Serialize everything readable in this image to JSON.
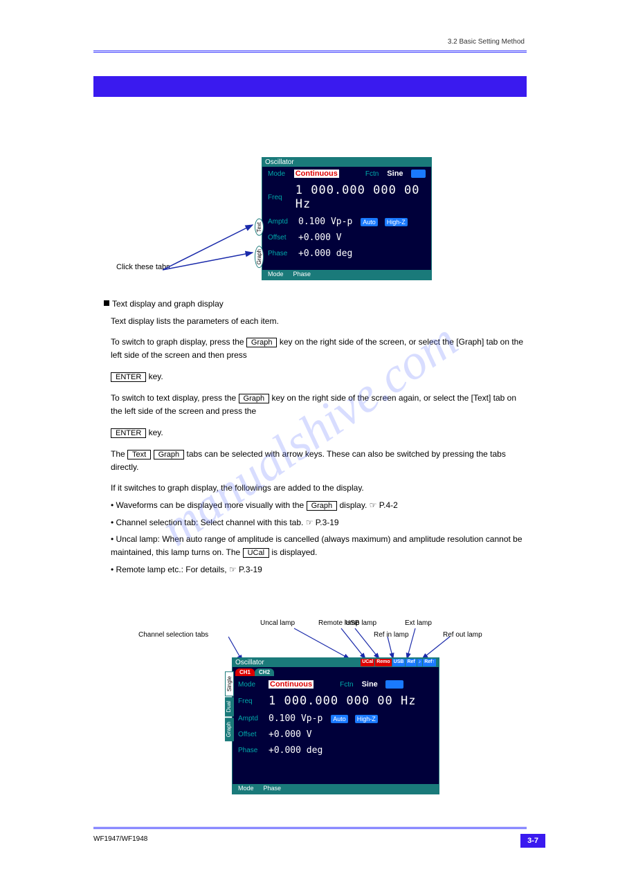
{
  "header_right": "3.2 Basic Setting Method",
  "bar_title": "",
  "device": {
    "title": "Oscillator",
    "mode_label": "Mode",
    "mode_value": "Continuous",
    "fctn_label": "Fctn",
    "fctn_value": "Sine",
    "freq_label": "Freq",
    "freq_value": "1 000.000 000 00 Hz",
    "amptd_label": "Amptd",
    "amptd_value": "0.100 Vp-p",
    "auto_badge": "Auto",
    "highz_badge": "High-Z",
    "offset_label": "Offset",
    "offset_value": "+0.000 V",
    "phase_label": "Phase",
    "phase_value": "+0.000 deg",
    "menu_mode": "Mode",
    "menu_phase": "Phase",
    "tab_text": "Text",
    "tab_graph": "Graph",
    "tab_single": "Single",
    "tab_dual": "Dual",
    "ch1": "CH1",
    "ch2": "CH2"
  },
  "callouts": {
    "click": "Click these tabs",
    "channel": "Channel selection tabs",
    "uncal": "Uncal lamp",
    "remote": "Remote lamp",
    "usb": "USB lamp",
    "refin": "Ref in lamp",
    "ext": "Ext lamp",
    "refout": "Ref out lamp"
  },
  "status": {
    "ucal": "UCal",
    "remp": "Remo",
    "usb": "USB",
    "ref": "Ref",
    "ext": "♪",
    "reft": "Ref↑"
  },
  "para1": "Text display and graph display",
  "para2": "Text display lists the parameters of each item.",
  "para3_a": "To switch to graph display, press the",
  "para3_key": "Graph",
  "para3_b": " key on the right side of the screen, or select the [Graph] tab on the left side of the screen and then press",
  "para3_key2": "ENTER",
  "para3_c": " key.",
  "para4_a": "To switch to text display, press the",
  "para4_key": "Graph",
  "para4_b": " key on the right side of the screen again, or select the [Text] tab on the left side of the screen and press the",
  "para4_key2": "ENTER",
  "para4_c": " key.",
  "para5_a": "The",
  "para5_key1": "Text",
  "para5_key2": "Graph",
  "para5_b": " tabs can be selected with arrow keys. These can also be switched by pressing the tabs directly.",
  "para6": "If it switches to graph display, the followings are added to the display.",
  "para7_a": "• Waveforms can be displayed more visually with the",
  "para7_key": "Graph",
  "para7_b": " display. ☞ P.4-2",
  "para8": "• Channel selection tab: Select channel with this tab. ☞ P.3-19",
  "para9_a": "• Uncal lamp: When auto range of amplitude is cancelled (always maximum) and amplitude resolution cannot be maintained, this lamp turns on. The",
  "para9_key": "UCal",
  "para9_b": " is displayed.",
  "para10": "• Remote lamp etc.: For details, ☞ P.3-19",
  "footer_left": "WF1947/WF1948",
  "page_num": "3-7",
  "watermark": "manualshive.com"
}
